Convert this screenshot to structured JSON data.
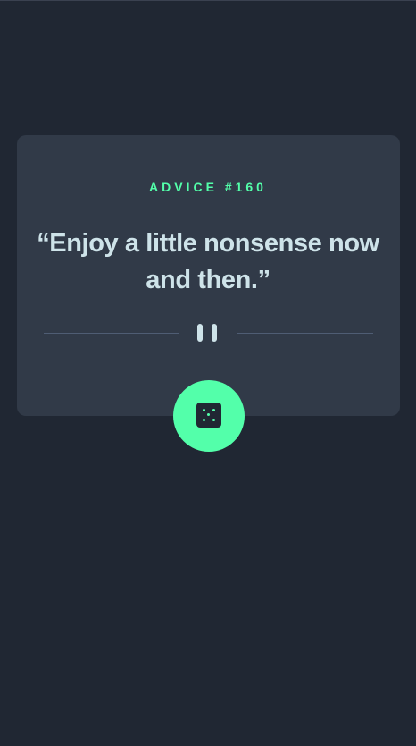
{
  "advice": {
    "label": "ADVICE #160",
    "quote": "“Enjoy a little nonsense now and then.”"
  },
  "icons": {
    "divider": "pause-icon",
    "generate": "dice-icon"
  },
  "colors": {
    "background": "#202733",
    "card": "#313a48",
    "accent": "#53ffaa",
    "text": "#cee3e9",
    "divider": "#4f5d74"
  }
}
